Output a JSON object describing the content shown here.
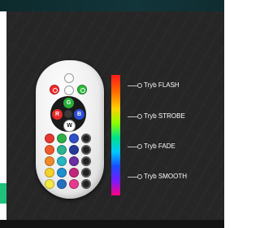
{
  "remote": {
    "buttons": {
      "red": "R",
      "green": "G",
      "blue": "B",
      "white": "W"
    },
    "color_grid": [
      [
        "#e8372f",
        "#2fae47",
        "#2e4fc8"
      ],
      [
        "#f05a2a",
        "#2bb48e",
        "#253a9a"
      ],
      [
        "#f08a27",
        "#27b6c2",
        "#6a2fa0"
      ],
      [
        "#f6d22a",
        "#1e8fd0",
        "#c2267a"
      ],
      [
        "#f5e845",
        "#2470c0",
        "#e63a8f"
      ]
    ]
  },
  "modes": [
    {
      "label": "Tryb FLASH"
    },
    {
      "label": "Tryb STROBE"
    },
    {
      "label": "Tryb FADE"
    },
    {
      "label": "Tryb SMOOTH"
    }
  ]
}
